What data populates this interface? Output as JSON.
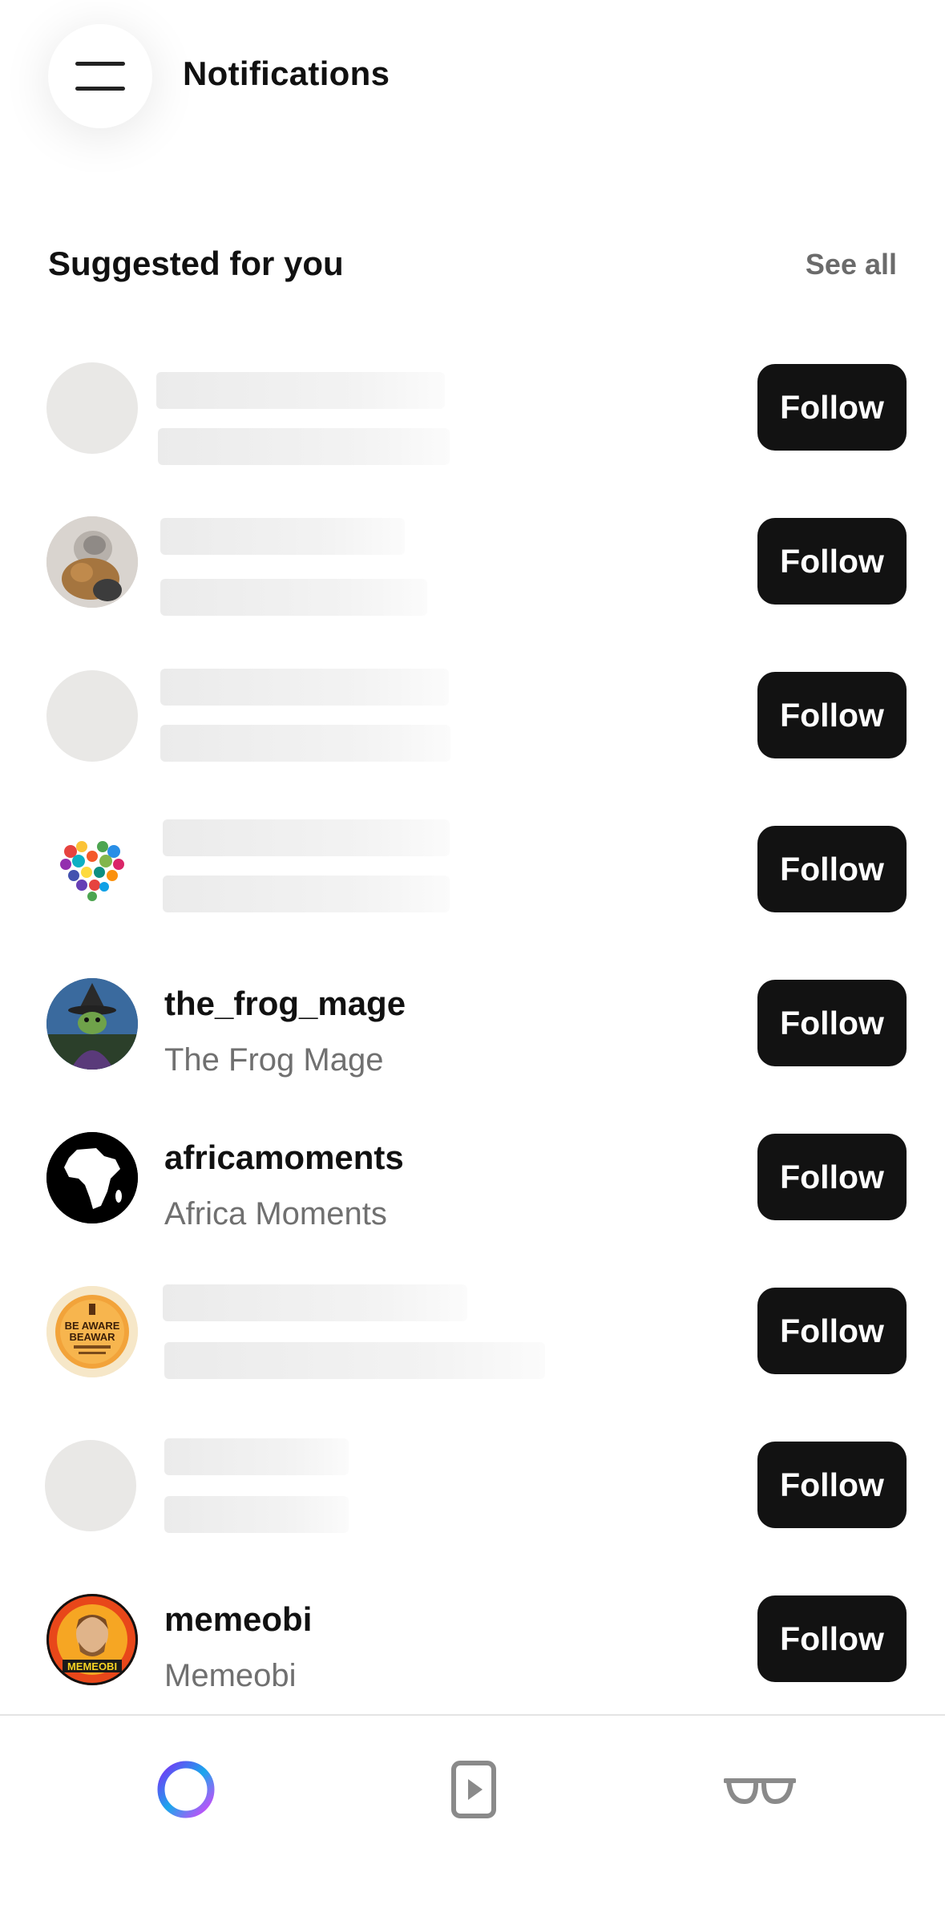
{
  "header": {
    "title": "Notifications",
    "menu_icon": "hamburger-menu-icon"
  },
  "suggested": {
    "title": "Suggested for you",
    "see_all": "See all"
  },
  "rows": [
    {
      "loading": true,
      "avatar": "blank",
      "handle": "",
      "name": "",
      "follow": "Follow"
    },
    {
      "loading": true,
      "avatar": "person-with-cat",
      "handle": "",
      "name": "",
      "follow": "Follow"
    },
    {
      "loading": true,
      "avatar": "blank",
      "handle": "",
      "name": "",
      "follow": "Follow"
    },
    {
      "loading": true,
      "avatar": "butterfly-heart",
      "handle": "",
      "name": "",
      "follow": "Follow"
    },
    {
      "loading": false,
      "avatar": "frog-mage",
      "handle": "the_frog_mage",
      "name": "The Frog Mage",
      "follow": "Follow"
    },
    {
      "loading": false,
      "avatar": "africa-map",
      "handle": "africamoments",
      "name": "Africa Moments",
      "follow": "Follow"
    },
    {
      "loading": true,
      "avatar": "be-aware-beawar",
      "avatar_text": [
        "BE AWARE",
        "BEAWAR"
      ],
      "handle": "",
      "name": "",
      "follow": "Follow"
    },
    {
      "loading": true,
      "avatar": "blank",
      "handle": "",
      "name": "",
      "follow": "Follow"
    },
    {
      "loading": false,
      "avatar": "memeobi",
      "avatar_text": [
        "MEMEOBI"
      ],
      "handle": "memeobi",
      "name": "Memeobi",
      "follow": "Follow"
    }
  ],
  "nav": [
    {
      "icon": "home-ring-icon"
    },
    {
      "icon": "reels-icon"
    },
    {
      "icon": "glasses-icon"
    }
  ],
  "colors": {
    "follow_bg": "#121212",
    "secondary_text": "#707070",
    "ring_gradient": [
      "#7b2ff7",
      "#1aa7ec",
      "#e040fb"
    ]
  }
}
